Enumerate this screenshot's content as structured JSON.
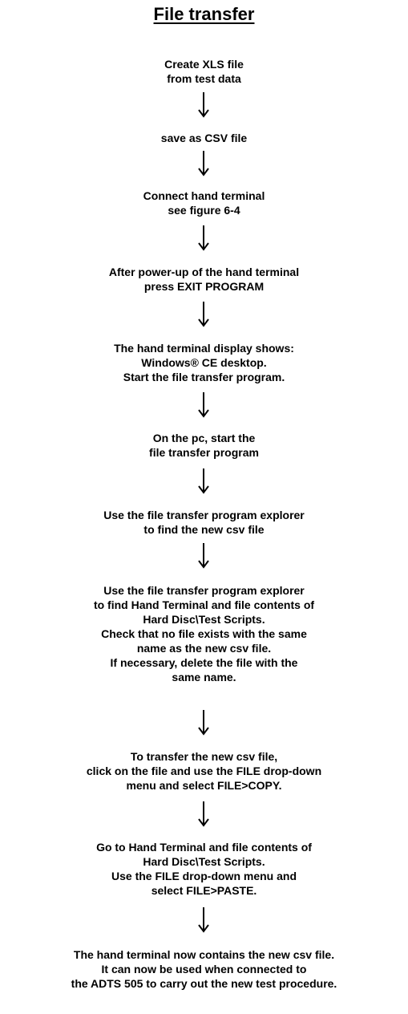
{
  "title": "File transfer",
  "steps": [
    [
      "Create XLS file",
      "from test data"
    ],
    [
      "save as CSV file"
    ],
    [
      "Connect hand terminal",
      "see figure 6-4"
    ],
    [
      "After power-up of the hand terminal",
      "press EXIT PROGRAM"
    ],
    [
      "The hand terminal display shows:",
      "Windows® CE desktop.",
      "Start the file transfer program."
    ],
    [
      "On the pc, start the",
      "file transfer program"
    ],
    [
      "Use the file transfer program explorer",
      "to find the new csv file"
    ],
    [
      "Use the file transfer program explorer",
      "to find Hand Terminal and file contents of",
      "Hard Disc\\Test Scripts.",
      "Check that no file exists with the same",
      "name as the new csv file.",
      "If necessary, delete the file with the",
      "same name."
    ],
    [
      "To transfer the new csv file,",
      "click on the file and use the FILE drop-down",
      "menu and select FILE>COPY."
    ],
    [
      "Go to Hand Terminal and file contents of",
      "Hard Disc\\Test Scripts.",
      "Use the FILE drop-down menu and",
      "select FILE>PASTE."
    ],
    [
      "The hand terminal now contains the new csv file.",
      "It can now be used when connected to",
      "the ADTS 505 to carry out the new test procedure."
    ]
  ]
}
